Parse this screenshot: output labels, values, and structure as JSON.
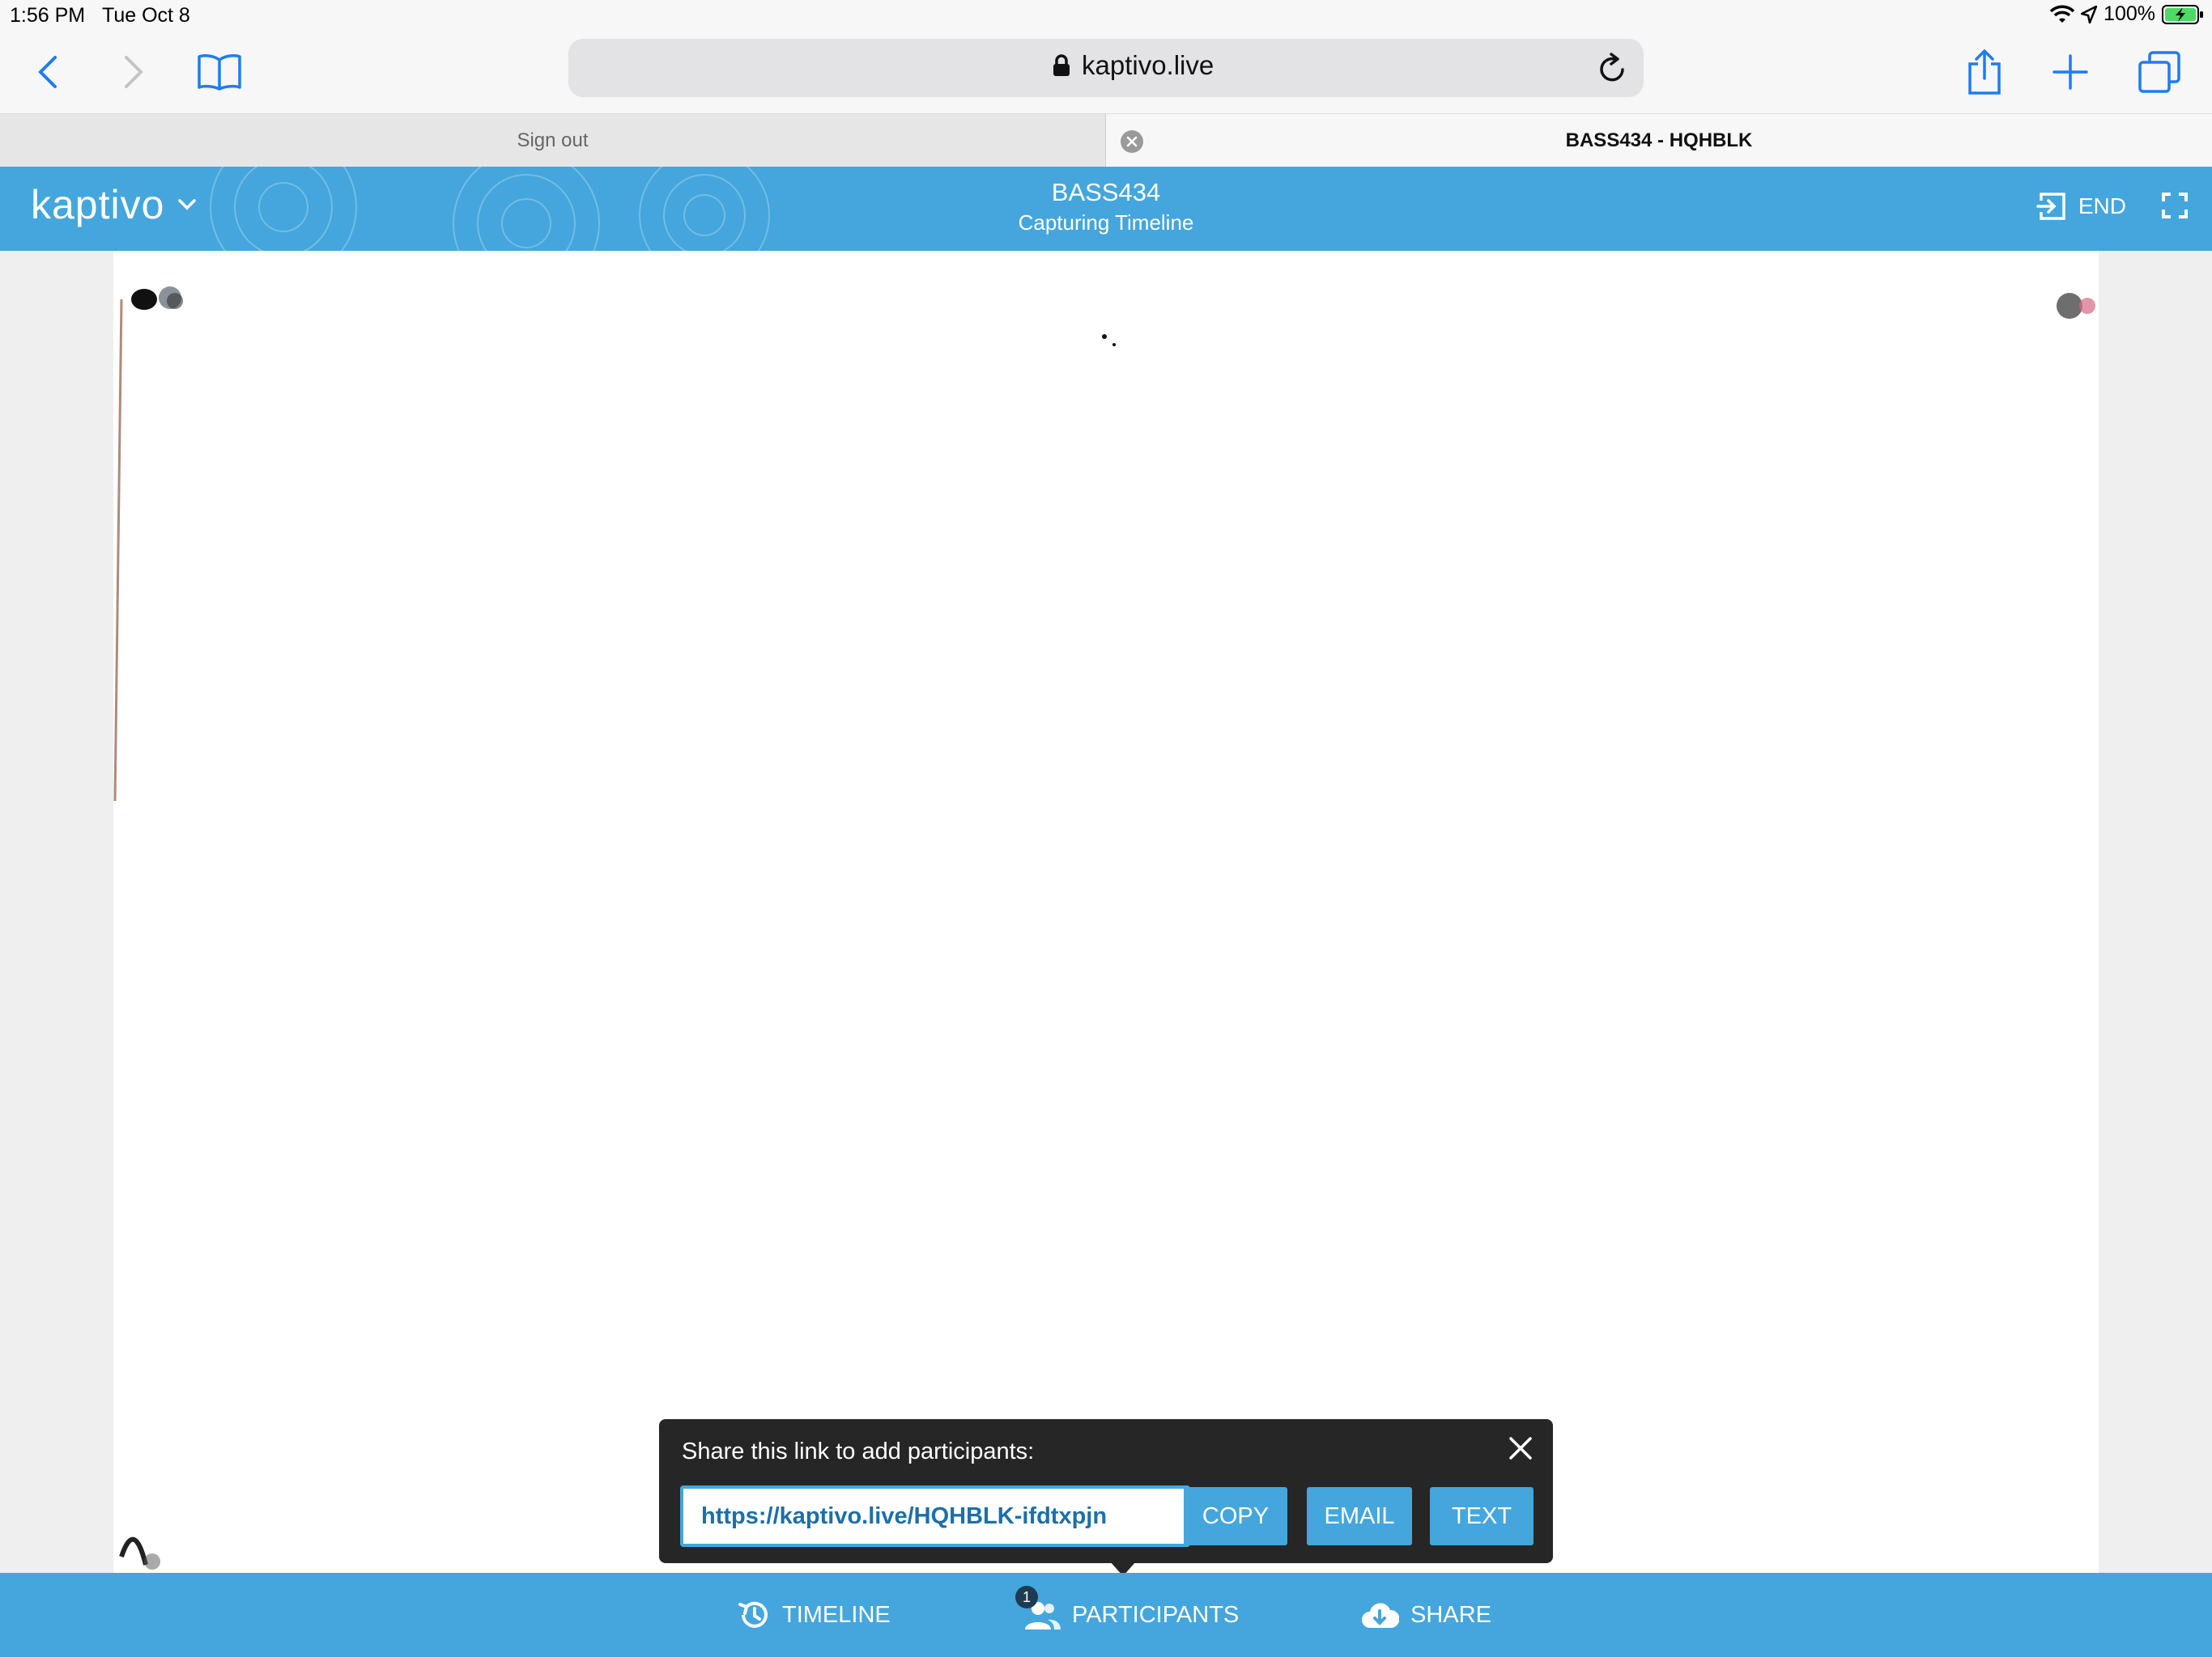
{
  "status_bar": {
    "time": "1:56 PM",
    "date": "Tue Oct 8",
    "battery": "100%",
    "icons": [
      "wifi-icon",
      "location-arrow-icon",
      "battery-charging-icon"
    ]
  },
  "browser": {
    "url": "kaptivo.live",
    "icons": [
      "back-icon",
      "forward-icon",
      "bookmarks-icon",
      "lock-icon",
      "reload-icon",
      "share-icon",
      "new-tab-icon",
      "tabs-icon"
    ],
    "tabs": [
      {
        "label": "Sign out",
        "active": false
      },
      {
        "label": "BASS434 - HQHBLK",
        "active": true
      }
    ]
  },
  "app_header": {
    "logo": "kaptivo",
    "session_code": "BASS434",
    "status": "Capturing Timeline",
    "end_label": "END",
    "accent_color": "#44a6dc"
  },
  "share_popover": {
    "title": "Share this link to add participants:",
    "link": "https://kaptivo.live/HQHBLK-ifdtxpjn",
    "copy_label": "COPY",
    "email_label": "EMAIL",
    "text_label": "TEXT"
  },
  "bottom_bar": {
    "timeline_label": "TIMELINE",
    "participants_label": "PARTICIPANTS",
    "participants_count": "1",
    "share_label": "SHARE"
  }
}
